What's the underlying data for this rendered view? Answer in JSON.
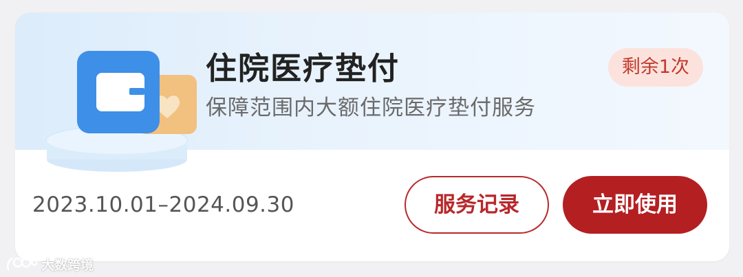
{
  "service": {
    "title": "住院医疗垫付",
    "description": "保障范围内大额住院医疗垫付服务",
    "remaining": "剩余1次",
    "validity": "2023.10.01–2024.09.30"
  },
  "actions": {
    "records_label": "服务记录",
    "use_label": "立即使用"
  },
  "watermark": {
    "text": "大数跨境"
  },
  "colors": {
    "accent": "#b41f22",
    "badge_bg": "#fce2dd",
    "header_bg": "#e3effc",
    "icon_blue": "#3d8fe8"
  },
  "icons": {
    "illustration": "wallet-with-heart-card-icon",
    "watermark_logo": "brand-logo-icon"
  }
}
